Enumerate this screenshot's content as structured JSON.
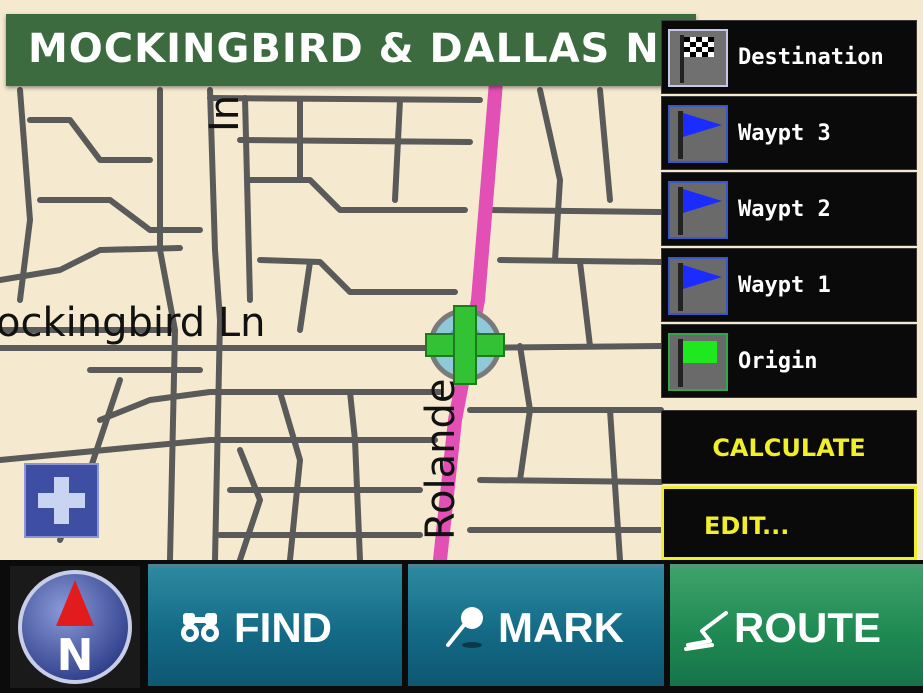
{
  "map": {
    "street_banner": "MOCKINGBIRD & DALLAS N",
    "labels": {
      "mockingbird": "ockingbird Ln",
      "roland": "Rolande",
      "top_street": "In"
    },
    "colors": {
      "background": "#f5ead0",
      "roads": "#5a5a5a",
      "route": "#e24fb5",
      "banner": "#3b6b3f"
    }
  },
  "route_menu": {
    "items": [
      {
        "label": "Destination",
        "icon": "checkered-flag-icon"
      },
      {
        "label": "Waypt 3",
        "icon": "blue-flag-icon"
      },
      {
        "label": "Waypt 2",
        "icon": "blue-flag-icon"
      },
      {
        "label": "Waypt 1",
        "icon": "blue-flag-icon"
      },
      {
        "label": "Origin",
        "icon": "green-flag-icon"
      }
    ],
    "calculate": "CALCULATE",
    "edit": "EDIT...",
    "accent": "#f1ee2a"
  },
  "toolbar": {
    "compass_letter": "N",
    "find": "FIND",
    "mark": "MARK",
    "route": "ROUTE"
  }
}
